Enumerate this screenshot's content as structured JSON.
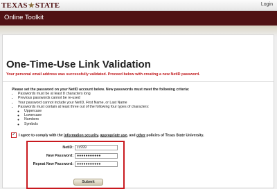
{
  "header": {
    "logo_text_left": "TEXAS",
    "logo_star": "★",
    "logo_text_right": "STATE",
    "login_label": "Login"
  },
  "banner": {
    "title": "Online Toolkit"
  },
  "main": {
    "title": "One-Time-Use Link Validation",
    "success_message": "Your personal email address was successfully validated. Proceed below with creating a new NetID password.",
    "criteria_intro": "Please set the password on your NetID account below. New passwords must meet the following criteria:",
    "criteria": [
      "Passwords must be at least 8 characters long",
      "Previous passwords cannot be re-used",
      "Your password cannot include your NetID, First Name, or Last Name",
      "Passwords must contain at least three out of the following four types of characters:"
    ],
    "char_types": [
      "Uppercase",
      "Lowercase",
      "Numbers",
      "Symbols"
    ],
    "agree": {
      "text_before": "I agree to comply with the ",
      "link1": "information security",
      "sep1": ", ",
      "link2": "appropriate use",
      "sep2": ", and ",
      "link3": "other",
      "text_after": " policies of Texas State University.",
      "checked": true
    },
    "form": {
      "netid_label": "NetID:",
      "netid_value": "zz999",
      "new_password_label": "New Password:",
      "new_password_value": "●●●●●●●●●●●",
      "repeat_password_label": "Repeat New Password:",
      "repeat_password_value": "●●●●●●●●●●●",
      "submit_label": "Submit"
    }
  },
  "colors": {
    "maroon": "#501214",
    "highlight_red": "#c8191f",
    "success_red": "#c0181b"
  }
}
